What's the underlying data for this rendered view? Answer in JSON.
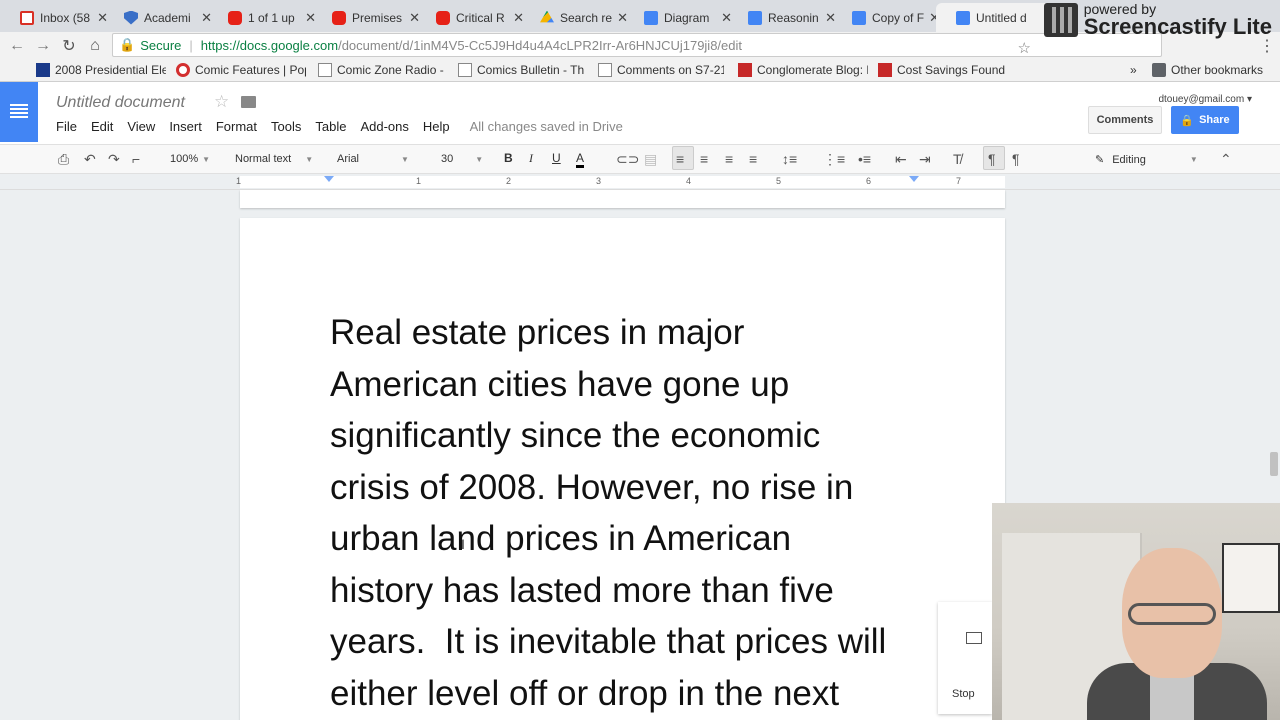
{
  "browser": {
    "tabs": [
      {
        "label": "Inbox (58",
        "icon": "gmail-icon"
      },
      {
        "label": "Academi",
        "icon": "shield-icon"
      },
      {
        "label": "1 of 1 up",
        "icon": "youtube-icon"
      },
      {
        "label": "Premises",
        "icon": "youtube-icon"
      },
      {
        "label": "Critical R",
        "icon": "youtube-icon"
      },
      {
        "label": "Search re",
        "icon": "drive-icon"
      },
      {
        "label": "Diagram",
        "icon": "docs-icon"
      },
      {
        "label": "Reasonin",
        "icon": "docs-icon"
      },
      {
        "label": "Copy of F",
        "icon": "docs-icon"
      },
      {
        "label": "Untitled d",
        "icon": "docs-icon"
      }
    ],
    "address": {
      "secure_label": "Secure",
      "url_host": "https://docs.google.com",
      "url_path": "/document/d/1inM4V5-Cc5J9Hd4u4A4cLPR2Irr-Ar6HNJCUj179ji8/edit"
    },
    "bookmarks": [
      {
        "label": "2008 Presidential Ele"
      },
      {
        "label": "Comic Features | Pop"
      },
      {
        "label": "Comic Zone Radio - F"
      },
      {
        "label": "Comics Bulletin - The"
      },
      {
        "label": "Comments on S7-21-"
      },
      {
        "label": "Conglomerate Blog: E"
      },
      {
        "label": "Cost Savings Found"
      }
    ],
    "bookmarks_more": "»",
    "other_bookmarks": "Other bookmarks"
  },
  "watermark": {
    "line1": "powered by",
    "line2": "Screencastify Lite"
  },
  "docs": {
    "title": "Untitled document",
    "menu": [
      "File",
      "Edit",
      "View",
      "Insert",
      "Format",
      "Tools",
      "Table",
      "Add-ons",
      "Help"
    ],
    "save_status": "All changes saved in Drive",
    "account": "dtouey@gmail.com",
    "comments_label": "Comments",
    "share_label": "Share",
    "toolbar": {
      "zoom": "100%",
      "style": "Normal text",
      "font": "Arial",
      "size": "30",
      "mode": "Editing"
    },
    "ruler_numbers": [
      "1",
      "1",
      "2",
      "3",
      "4",
      "5",
      "6",
      "7"
    ],
    "body_lines": [
      "Real estate prices in major",
      "American cities have gone up",
      "significantly since the economic",
      "crisis of 2008. However, no rise in",
      "urban land prices in American",
      "history has lasted more than five",
      "years.  It is inevitable that prices will",
      "either level off or drop in the next"
    ],
    "stop_label": "Stop"
  }
}
